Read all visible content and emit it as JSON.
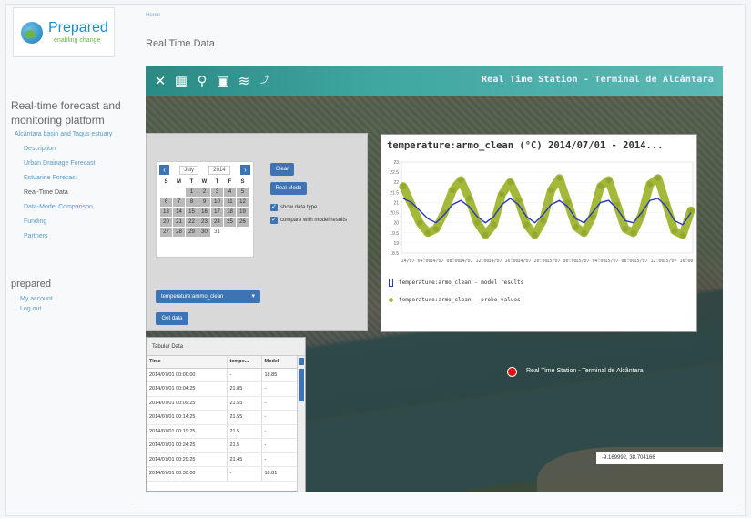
{
  "logo": {
    "name": "Prepared",
    "tagline": "enabling change"
  },
  "breadcrumb": "Home",
  "page_title": "Real Time Data",
  "sidebar": {
    "heading": "Real-time forecast and monitoring platform",
    "section": "Alcântara basin and Tagus estuary",
    "items": [
      {
        "label": "Description"
      },
      {
        "label": "Urban Drainage Forecast"
      },
      {
        "label": "Estuarine Forecast"
      },
      {
        "label": "Real-Time Data"
      },
      {
        "label": "Data-Model Comparison"
      },
      {
        "label": "Funding"
      },
      {
        "label": "Partners"
      }
    ],
    "account_title": "prepared",
    "account_links": [
      "My account",
      "Log out"
    ]
  },
  "toolbar": {
    "icons": [
      "tools-icon",
      "calendar-icon",
      "zoom-icon",
      "layer-icon",
      "wifi-icon",
      "share-icon"
    ],
    "station_title": "Real Time Station - Terminal de Alcântara"
  },
  "date_panel": {
    "month": "July",
    "year": "2014",
    "prev": "‹",
    "next": "›",
    "weekdays": [
      "S",
      "M",
      "T",
      "W",
      "T",
      "F",
      "S"
    ],
    "days": [
      "",
      "",
      "1",
      "2",
      "3",
      "4",
      "5",
      "6",
      "7",
      "8",
      "9",
      "10",
      "11",
      "12",
      "13",
      "14",
      "15",
      "16",
      "17",
      "18",
      "19",
      "20",
      "21",
      "22",
      "23",
      "24",
      "25",
      "26",
      "27",
      "28",
      "29",
      "30",
      "31"
    ],
    "clear_label": "Clear",
    "real_mode_label": "Real Mode",
    "options": [
      "show data type",
      "compare with model results"
    ],
    "variable_select": "temperature:ammo_clean",
    "get_data_label": "Get data"
  },
  "chart": {
    "title": "temperature:armo_clean (°C) 2014/07/01 - 2014...",
    "legend": [
      "temperature:armo_clean - model results",
      "temperature:armo_clean - probe values"
    ],
    "x_tick_labels": [
      "14/07 04:00",
      "14/07 08:00",
      "14/07 12:00",
      "14/07 16:00",
      "14/07 20:00",
      "15/07 00:00",
      "15/07 04:00",
      "15/07 08:00",
      "15/07 12:00",
      "15/07 16:00"
    ],
    "y_tick_labels": [
      "23",
      "22.5",
      "22",
      "21.5",
      "21",
      "20.5",
      "20",
      "19.5",
      "19",
      "18.5"
    ],
    "colors": {
      "model": "#2a3ab8",
      "probe": "#a4b839"
    }
  },
  "chart_data": {
    "type": "line",
    "y_unit": "°C",
    "ylim": [
      18.5,
      23
    ],
    "series": [
      {
        "name": "temperature:armo_clean - model results",
        "values": [
          21.2,
          21.0,
          20.6,
          20.2,
          20.0,
          20.4,
          20.9,
          21.1,
          20.8,
          20.3,
          20.0,
          20.3,
          20.9,
          21.2,
          20.9,
          20.3,
          20.0,
          20.4,
          20.9,
          21.1,
          20.8,
          20.2,
          20.0,
          20.5,
          21.0,
          21.1,
          20.7,
          20.1,
          20.0,
          20.5,
          21.1,
          21.2,
          20.8,
          20.1,
          19.9,
          20.5
        ]
      },
      {
        "name": "temperature:armo_clean - probe values",
        "values": [
          21.8,
          20.9,
          20.0,
          19.5,
          19.7,
          20.5,
          21.6,
          22.1,
          21.2,
          20.0,
          19.4,
          19.9,
          21.4,
          22.0,
          21.1,
          19.9,
          19.4,
          20.1,
          21.6,
          22.2,
          21.0,
          19.8,
          19.5,
          20.3,
          21.8,
          22.1,
          20.9,
          19.7,
          19.5,
          20.4,
          21.9,
          22.2,
          20.9,
          19.6,
          19.4,
          20.6
        ]
      }
    ]
  },
  "table": {
    "title": "Tabular Data",
    "headers": [
      "Time",
      "tempe...",
      "Model"
    ],
    "rows": [
      [
        "2014/07/01 00:00:00",
        "-",
        "18.85"
      ],
      [
        "2014/07/01 00:04:25",
        "21.85",
        "-"
      ],
      [
        "2014/07/01 00:09:25",
        "21.55",
        "-"
      ],
      [
        "2014/07/01 00:14:25",
        "21.55",
        "-"
      ],
      [
        "2014/07/01 00:19:25",
        "21.5",
        "-"
      ],
      [
        "2014/07/01 00:24:25",
        "21.5",
        "-"
      ],
      [
        "2014/07/01 00:29:25",
        "21.45",
        "-"
      ],
      [
        "2014/07/01 00:30:00",
        "-",
        "18.81"
      ]
    ]
  },
  "map": {
    "marker_label": "Real Time Station - Terminal de Alcântara",
    "coords": "-9.169992, 38.704166"
  }
}
